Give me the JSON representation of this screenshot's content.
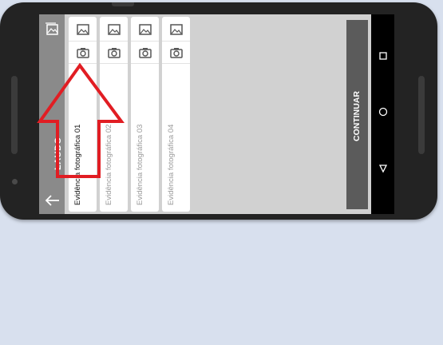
{
  "app": {
    "title": "LAUDO"
  },
  "cards": [
    {
      "label": "Evidência fotográfica 01",
      "active": true
    },
    {
      "label": "Evidência fotográfica 02",
      "active": false
    },
    {
      "label": "Evidência fotográfica 03",
      "active": false
    },
    {
      "label": "Evidência fotográfica 04",
      "active": false
    }
  ],
  "buttons": {
    "continue_label": "CONTINUAR"
  },
  "icons": {
    "gallery": "gallery-icon",
    "camera": "camera-icon",
    "back": "back-arrow-icon"
  },
  "colors": {
    "annotation": "#e11d23",
    "sidebar": "#8a8a8a",
    "continue_button": "#5b5b5b"
  }
}
